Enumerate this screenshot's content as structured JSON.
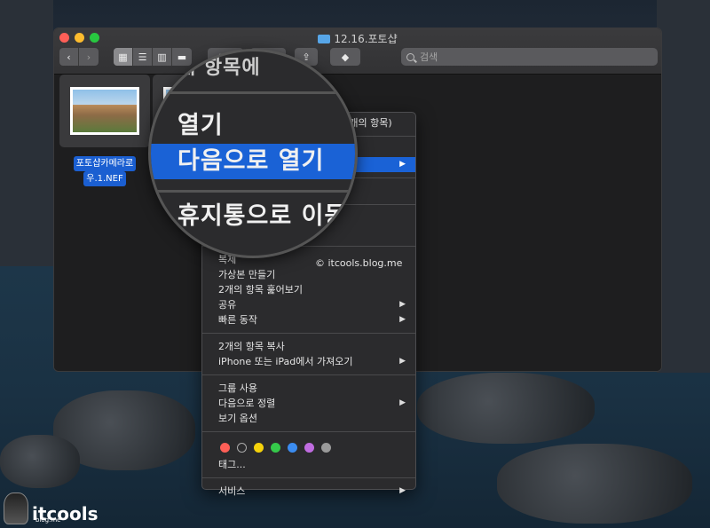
{
  "window": {
    "title": "12.16.포토샵"
  },
  "toolbar": {
    "back": "‹",
    "forward": "›",
    "view_modes": [
      "▦",
      "☰",
      "▥",
      "▬"
    ],
    "group_icon": "▦▾",
    "action_icon": "✱▾",
    "share_icon": "⇪",
    "tag_icon": "◆",
    "search_placeholder": "검색"
  },
  "files": [
    {
      "label_lines": [
        "포토샵카메라로",
        "우.1.NEF"
      ],
      "selected": true
    },
    {
      "label_lines": [],
      "selected": true
    }
  ],
  "context_menu": {
    "top_partial": "더(2개의 항목)",
    "items_group1": [
      {
        "label": "복제",
        "submenu": false
      },
      {
        "label": "가상본 만들기",
        "submenu": false
      },
      {
        "label": "2개의 항목 훑어보기",
        "submenu": false
      },
      {
        "label": "공유",
        "submenu": true
      },
      {
        "label": "빠른 동작",
        "submenu": true
      }
    ],
    "items_group2": [
      {
        "label": "2개의 항목 복사",
        "submenu": false
      },
      {
        "label": "iPhone 또는 iPad에서 가져오기",
        "submenu": true
      }
    ],
    "items_group3": [
      {
        "label": "그룹 사용",
        "submenu": false
      },
      {
        "label": "다음으로 정렬",
        "submenu": true
      },
      {
        "label": "보기 옵션",
        "submenu": false
      }
    ],
    "tag_colors": [
      "#ff5f57",
      "#2b2b2d",
      "#f5d20b",
      "#35c94a",
      "#3b8cf0",
      "#c06ce0",
      "#9a9a9a"
    ],
    "tags_label": "태그...",
    "services_label": "서비스",
    "submenu_arrow": "▶"
  },
  "magnifier": {
    "top_partial": "개 항목에",
    "open": "열기",
    "open_with": "다음으로 열기",
    "trash": "휴지통으로 이동"
  },
  "watermark": "© itcools.blog.me",
  "logo": {
    "text": "itcools",
    "sub": "blog.me"
  }
}
